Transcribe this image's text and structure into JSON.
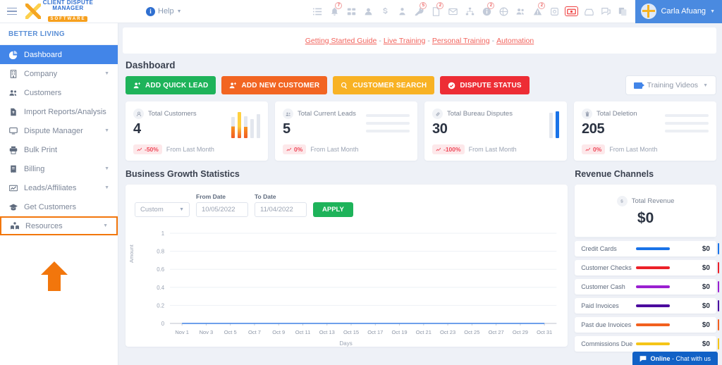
{
  "topbar": {
    "help_label": "Help",
    "user_name": "Carla Afuang",
    "icons": [
      {
        "name": "list-icon",
        "badge": ""
      },
      {
        "name": "bell-icon",
        "badge": "7"
      },
      {
        "name": "sitemap-icon",
        "badge": ""
      },
      {
        "name": "user-icon",
        "badge": ""
      },
      {
        "name": "dollar-icon",
        "badge": ""
      },
      {
        "name": "user-tie-icon",
        "badge": ""
      },
      {
        "name": "key-icon",
        "badge": "5"
      },
      {
        "name": "file-icon",
        "badge": "2"
      },
      {
        "name": "envelope-icon",
        "badge": ""
      },
      {
        "name": "hierarchy-icon",
        "badge": ""
      },
      {
        "name": "info-icon",
        "badge": "2"
      },
      {
        "name": "globe-icon",
        "badge": ""
      },
      {
        "name": "users-icon",
        "badge": ""
      },
      {
        "name": "warning-icon",
        "badge": "2"
      },
      {
        "name": "archive-icon",
        "badge": ""
      },
      {
        "name": "money-icon",
        "badge": ""
      },
      {
        "name": "inbox-icon",
        "badge": ""
      },
      {
        "name": "comments-icon",
        "badge": ""
      },
      {
        "name": "copy-icon",
        "badge": ""
      }
    ]
  },
  "logo": {
    "line1": "CLIENT DISPUTE",
    "line2": "MANAGER",
    "line3": "SOFTWARE"
  },
  "sidebar": {
    "title": "BETTER LIVING",
    "items": [
      {
        "label": "Dashboard",
        "icon": "pie-chart-icon",
        "active": true,
        "caret": false
      },
      {
        "label": "Company",
        "icon": "building-icon",
        "active": false,
        "caret": true
      },
      {
        "label": "Customers",
        "icon": "users-icon",
        "active": false,
        "caret": false
      },
      {
        "label": "Import Reports/Analysis",
        "icon": "file-import-icon",
        "active": false,
        "caret": false
      },
      {
        "label": "Dispute Manager",
        "icon": "monitor-icon",
        "active": false,
        "caret": true
      },
      {
        "label": "Bulk Print",
        "icon": "printer-icon",
        "active": false,
        "caret": false
      },
      {
        "label": "Billing",
        "icon": "invoice-icon",
        "active": false,
        "caret": true
      },
      {
        "label": "Leads/Affiliates",
        "icon": "chart-line-icon",
        "active": false,
        "caret": true
      },
      {
        "label": "Get Customers",
        "icon": "graduation-cap-icon",
        "active": false,
        "caret": false
      },
      {
        "label": "Resources",
        "icon": "book-reader-icon",
        "active": false,
        "caret": true,
        "highlight": true
      }
    ]
  },
  "linkbar": {
    "links": [
      "Getting Started Guide",
      "Live Training",
      "Personal Training",
      "Automation"
    ],
    "separator": "-"
  },
  "page": {
    "title": "Dashboard"
  },
  "actions": [
    {
      "label": "ADD QUICK LEAD",
      "color": "green",
      "icon": "user-plus-icon"
    },
    {
      "label": "ADD NEW CUSTOMER",
      "color": "orange",
      "icon": "user-plus-icon"
    },
    {
      "label": "CUSTOMER SEARCH",
      "color": "yellow",
      "icon": "search-icon"
    },
    {
      "label": "DISPUTE STATUS",
      "color": "red",
      "icon": "check-circle-icon"
    }
  ],
  "training_videos": {
    "label": "Training Videos",
    "icon": "video-icon"
  },
  "stat_cards": [
    {
      "label": "Total Customers",
      "value": "4",
      "change": "-50%",
      "change_note": "From Last Month",
      "icon": "user-icon",
      "visual": "bars"
    },
    {
      "label": "Total Current Leads",
      "value": "5",
      "change": "0%",
      "change_note": "From Last Month",
      "icon": "users-icon",
      "visual": "lines"
    },
    {
      "label": "Total Bureau Disputes",
      "value": "30",
      "change": "-100%",
      "change_note": "From Last Month",
      "icon": "link-icon",
      "visual": "bluebars"
    },
    {
      "label": "Total Deletion",
      "value": "205",
      "change": "0%",
      "change_note": "From Last Month",
      "icon": "trash-icon",
      "visual": "lines"
    }
  ],
  "growth": {
    "title": "Business Growth Statistics",
    "range_select": "Custom",
    "from_label": "From Date",
    "from_value": "10/05/2022",
    "to_label": "To Date",
    "to_value": "11/04/2022",
    "apply_label": "APPLY"
  },
  "revenue": {
    "title": "Revenue Channels",
    "total_label": "Total Revenue",
    "total_value": "$0",
    "currency_icon": "dollar-icon",
    "rows": [
      {
        "name": "Credit Cards",
        "amount": "$0",
        "color": "#1a73e8"
      },
      {
        "name": "Customer Checks",
        "amount": "$0",
        "color": "#ec2128"
      },
      {
        "name": "Customer Cash",
        "amount": "$0",
        "color": "#9a1fd0"
      },
      {
        "name": "Paid Invoices",
        "amount": "$0",
        "color": "#4b0a9e"
      },
      {
        "name": "Past due Invoices",
        "amount": "$0",
        "color": "#f2601f"
      },
      {
        "name": "Commissions Due",
        "amount": "$0",
        "color": "#f5c518"
      }
    ]
  },
  "chat": {
    "status": "Online",
    "text": " - Chat with us",
    "icon": "chat-icon"
  },
  "chart_data": {
    "type": "line",
    "title": "Business Growth Statistics",
    "xlabel": "Days",
    "ylabel": "Amount",
    "ylim": [
      0,
      1
    ],
    "yticks": [
      "0",
      "0.2",
      "0.4",
      "0.6",
      "0.8",
      "1"
    ],
    "categories": [
      "Nov 1",
      "Nov 3",
      "Oct 5",
      "Oct 7",
      "Oct 9",
      "Oct 11",
      "Oct 13",
      "Oct 15",
      "Oct 17",
      "Oct 19",
      "Oct 21",
      "Oct 23",
      "Oct 25",
      "Oct 27",
      "Oct 29",
      "Oct 31"
    ],
    "series": [
      {
        "name": "Amount",
        "values": [
          0,
          0,
          0,
          0,
          0,
          0,
          0,
          0,
          0,
          0,
          0,
          0,
          0,
          0,
          0,
          0
        ]
      }
    ],
    "grid": true,
    "legend": "none"
  }
}
